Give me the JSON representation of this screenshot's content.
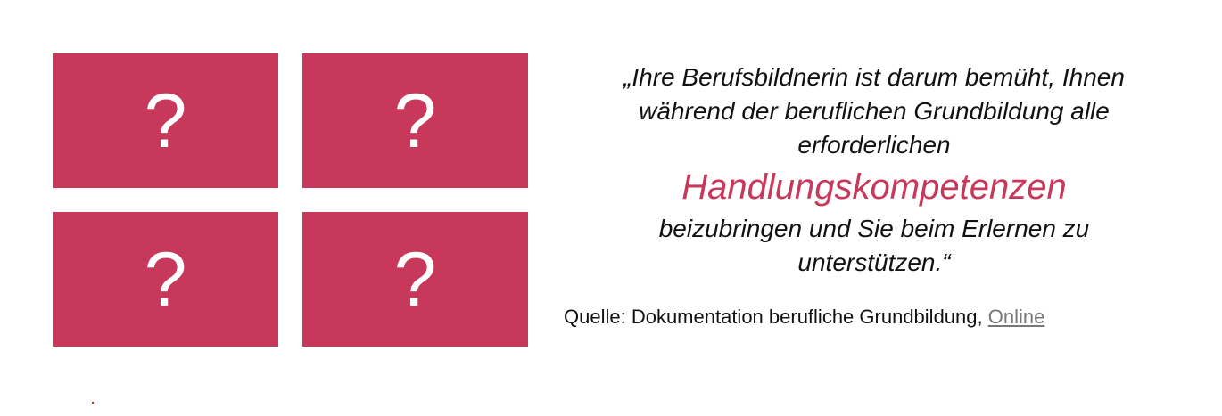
{
  "tiles": [
    {
      "label": "?"
    },
    {
      "label": "?"
    },
    {
      "label": "?"
    },
    {
      "label": "?"
    }
  ],
  "quote": {
    "line1": "„Ihre Berufsbildnerin ist darum bemüht, Ihnen",
    "line2": "während der beruflichen Grundbildung alle",
    "line3": "erforderlichen",
    "highlight": "Handlungskompetenzen",
    "line4": "beizubringen und Sie beim Erlernen zu",
    "line5": "unterstützen.“"
  },
  "source": {
    "prefix": "Quelle: Dokumentation berufliche Grundbildung, ",
    "link_label": "Online"
  },
  "colors": {
    "tile_background": "#c8385a",
    "highlight": "#c8385a",
    "link": "#777777"
  }
}
